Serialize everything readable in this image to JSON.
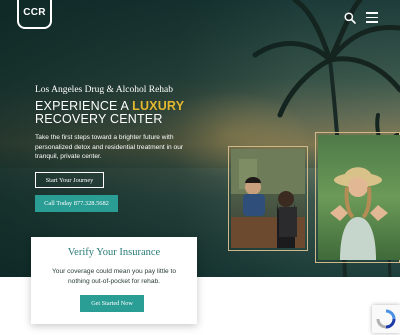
{
  "header": {
    "logo_text": "CCR",
    "search_icon": "search-icon",
    "menu_icon": "hamburger-menu-icon"
  },
  "hero": {
    "kicker": "Los Angeles Drug & Alcohol Rehab",
    "headline_prefix": "EXPERIENCE A",
    "headline_accent": "LUXURY",
    "headline_line2": "RECOVERY CENTER",
    "lead": "Take the first steps toward a brighter future with personalized detox and residential treatment in our tranquil, private center.",
    "cta_primary": "Start Your Journey",
    "cta_call": "Call Today 877.328.5682"
  },
  "verify": {
    "title": "Verify Your Insurance",
    "text": "Your coverage could mean you pay little to nothing out-of-pocket for rehab.",
    "button": "Get Started Now"
  },
  "colors": {
    "accent_gold": "#e2b82f",
    "teal_button": "#2a9d94",
    "heading_teal": "#2a7c78"
  }
}
